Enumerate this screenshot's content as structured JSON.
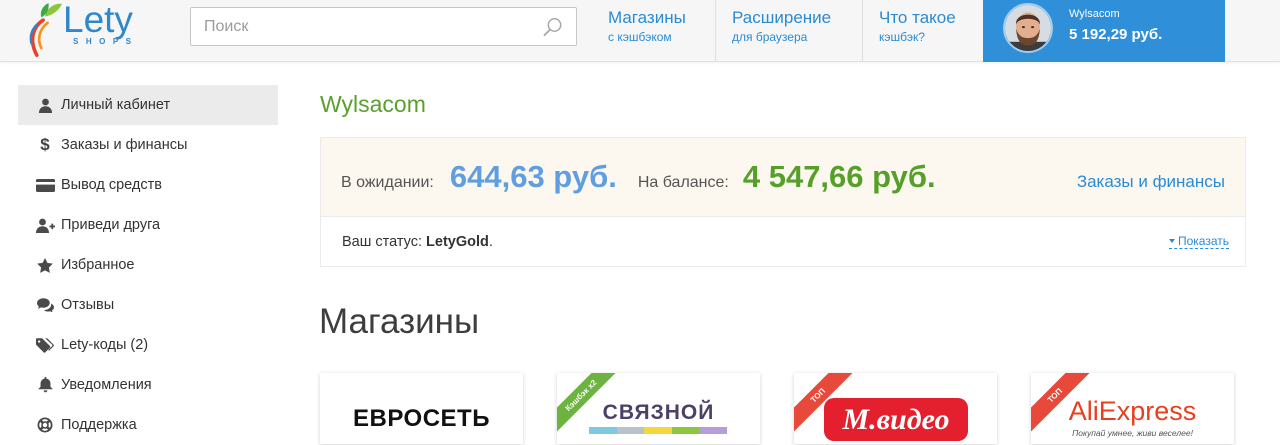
{
  "header": {
    "logo": {
      "text": "Lety",
      "sub": "SHOPS"
    },
    "search": {
      "placeholder": "Поиск",
      "icon": "search-icon"
    },
    "nav": [
      {
        "title": "Магазины",
        "subtitle": "с кэшбэком"
      },
      {
        "title": "Расширение",
        "subtitle": "для браузера"
      },
      {
        "title": "Что такое",
        "subtitle": "кэшбэк?"
      }
    ],
    "user": {
      "name": "Wylsacom",
      "balance": "5 192,29 руб."
    }
  },
  "sidebar": {
    "items": [
      {
        "label": "Личный кабинет",
        "icon": "user-icon",
        "active": true
      },
      {
        "label": "Заказы и финансы",
        "icon": "dollar-icon"
      },
      {
        "label": "Вывод средств",
        "icon": "credit-card-icon"
      },
      {
        "label": "Приведи друга",
        "icon": "user-plus-icon"
      },
      {
        "label": "Избранное",
        "icon": "star-icon"
      },
      {
        "label": "Отзывы",
        "icon": "comments-icon"
      },
      {
        "label": "Lety-коды (2)",
        "icon": "tags-icon"
      },
      {
        "label": "Уведомления",
        "icon": "bell-icon"
      },
      {
        "label": "Поддержка",
        "icon": "life-ring-icon"
      }
    ]
  },
  "main": {
    "title": "Wylsacom",
    "balance": {
      "pending_label": "В ожидании:",
      "pending_value": "644,63 руб.",
      "balance_label": "На балансе:",
      "balance_value": "4 547,66 руб.",
      "orders_link": "Заказы и финансы",
      "status_label": "Ваш статус:",
      "status_value": "LetyGold",
      "status_suffix": ".",
      "show_link": "Показать"
    },
    "stores_heading": "Магазины",
    "stores": [
      {
        "name": "ЕВРОСЕТЬ"
      },
      {
        "name": "СВЯЗНОЙ",
        "badge": "Кэшбэк x2"
      },
      {
        "name": "M.видео",
        "badge": "ТОП"
      },
      {
        "name": "AliExpress",
        "tagline": "Покупай умнее, живи веселее!",
        "badge": "ТОП"
      }
    ]
  },
  "colors": {
    "brand_blue": "#2a8bd5",
    "title_green": "#5aa02c",
    "pending_blue": "#5f9ee0",
    "balance_green": "#56a02a",
    "user_box": "#2f8fd8",
    "badge_green": "#6cb33f",
    "badge_red": "#e7493a",
    "status_panel_bg": "#fdf8ef"
  }
}
